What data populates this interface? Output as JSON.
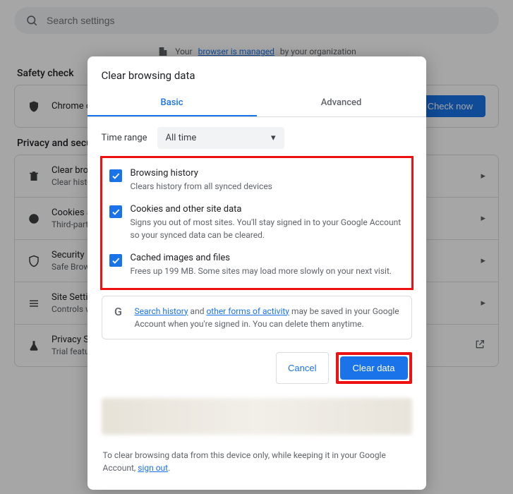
{
  "search": {
    "placeholder": "Search settings"
  },
  "managed": {
    "pre": "Your",
    "link": "browser is managed",
    "post": "by your organization"
  },
  "sections": {
    "safety": "Safety check",
    "privacy": "Privacy and security"
  },
  "safety_row": {
    "title": "Chrome can help keep you safe",
    "button": "Check now"
  },
  "privacy_rows": [
    {
      "title": "Clear browsing data",
      "sub": "Clear history, cookies, cache, and more"
    },
    {
      "title": "Cookies and other site data",
      "sub": "Third-party cookies are blocked in Incognito mode"
    },
    {
      "title": "Security",
      "sub": "Safe Browsing and other security settings"
    },
    {
      "title": "Site Settings",
      "sub": "Controls what information sites can use"
    },
    {
      "title": "Privacy Sandbox",
      "sub": "Trial features are on"
    }
  ],
  "dialog": {
    "title": "Clear browsing data",
    "tabs": {
      "basic": "Basic",
      "advanced": "Advanced"
    },
    "range": {
      "label": "Time range",
      "value": "All time"
    },
    "options": [
      {
        "title": "Browsing history",
        "desc": "Clears history from all synced devices"
      },
      {
        "title": "Cookies and other site data",
        "desc": "Signs you out of most sites. You'll stay signed in to your Google Account so your synced data can be cleared."
      },
      {
        "title": "Cached images and files",
        "desc": "Frees up 199 MB. Some sites may load more slowly on your next visit."
      }
    ],
    "note": {
      "link1": "Search history",
      "mid": " and ",
      "link2": "other forms of activity",
      "post": " may be saved in your Google Account when you're signed in. You can delete them anytime."
    },
    "actions": {
      "cancel": "Cancel",
      "clear": "Clear data"
    },
    "footer": {
      "pre": "To clear browsing data from this device only, while keeping it in your Google Account, ",
      "link": "sign out",
      "post": "."
    }
  }
}
